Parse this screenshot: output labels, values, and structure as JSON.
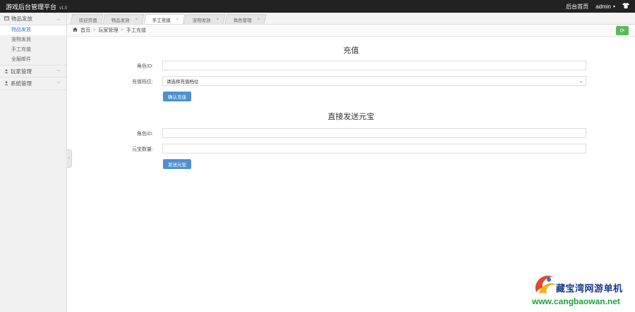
{
  "topbar": {
    "title": "游戏后台管理平台",
    "version": "v1.0",
    "nav_link": "后台首页",
    "username": "admin",
    "caret": "▾",
    "user_icon": "shirt-icon"
  },
  "sidebar": {
    "groups": [
      {
        "label": "物品发放",
        "icon": "box-icon",
        "items": [
          {
            "label": "物品发放",
            "active": true
          },
          {
            "label": "宠物发放",
            "active": false
          },
          {
            "label": "手工充值",
            "active": false
          },
          {
            "label": "全服邮件",
            "active": false
          }
        ]
      },
      {
        "label": "玩家管理",
        "icon": "person-icon"
      },
      {
        "label": "系统管理",
        "icon": "person-icon"
      }
    ]
  },
  "tabs": [
    {
      "label": "欢迎页面",
      "active": false,
      "closable": false
    },
    {
      "label": "物品发放",
      "active": false,
      "closable": true
    },
    {
      "label": "手工充值",
      "active": true,
      "closable": true
    },
    {
      "label": "宠物发放",
      "active": false,
      "closable": true
    },
    {
      "label": "角色管理",
      "active": false,
      "closable": true
    }
  ],
  "breadcrumb": {
    "home": "首页",
    "level1": "玩家管理",
    "level2": "手工充值",
    "separator": ">"
  },
  "recharge": {
    "title": "充值",
    "role_id_label": "角色ID:",
    "role_id_value": "",
    "package_label": "充值档位:",
    "package_selected": "请选择充值档位",
    "submit_label": "确认充值"
  },
  "yuanbao": {
    "title": "直接发送元宝",
    "role_id_label": "角色ID:",
    "role_id_value": "",
    "amount_label": "元宝数量:",
    "amount_value": "",
    "submit_label": "发送元宝"
  },
  "watermark": {
    "name": "藏宝湾网游单机",
    "url": "www.cangbaowan.net"
  },
  "colors": {
    "topbar": "#222222",
    "accent": "#4f8fd2",
    "refresh": "#5cb85c",
    "watermark_text": "#1b3a8c",
    "watermark_url": "#18a33b"
  }
}
